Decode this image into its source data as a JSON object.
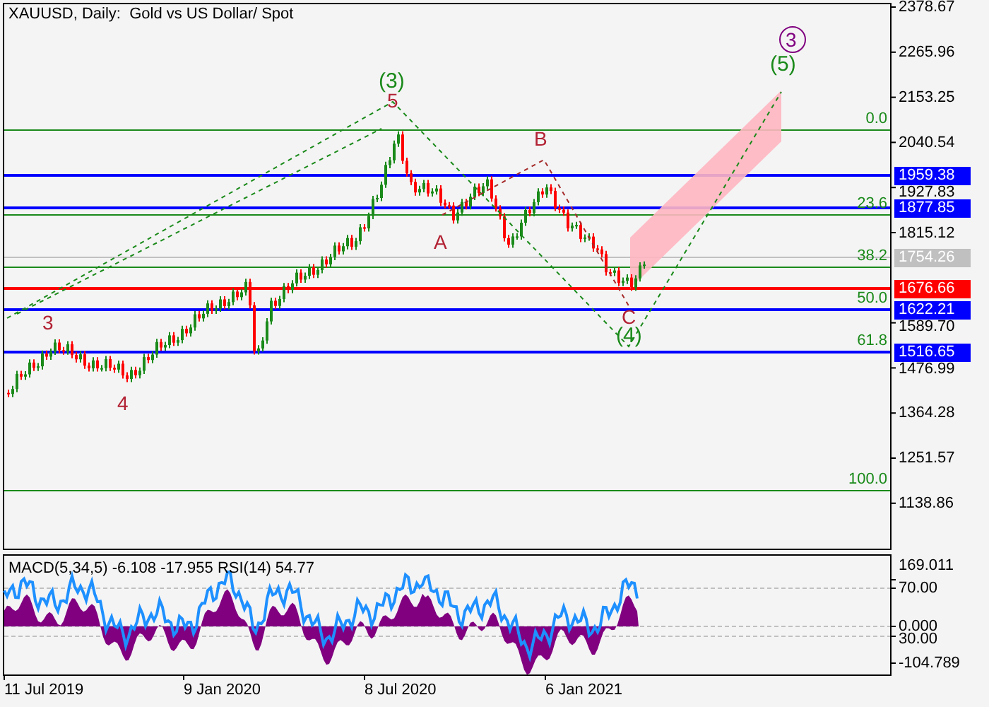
{
  "chart": {
    "title": "XAUUSD, Daily:  Gold vs US Dollar/ Spot",
    "price_axis": [
      "2378.67",
      "2265.96",
      "2153.25",
      "2040.54",
      "1927.83",
      "1815.12",
      "1589.70",
      "1476.99",
      "1364.28",
      "1251.57",
      "1138.86"
    ],
    "price_tags": [
      {
        "text": "1959.38",
        "color": "#0000ff"
      },
      {
        "text": "1877.85",
        "color": "#0000ff"
      },
      {
        "text": "1754.26",
        "color": "#c0c0c0"
      },
      {
        "text": "1676.66",
        "color": "#ff0000"
      },
      {
        "text": "1622.21",
        "color": "#0000ff"
      },
      {
        "text": "1516.65",
        "color": "#0000ff"
      }
    ],
    "fib_levels": [
      "0.0",
      "23.6",
      "38.2",
      "50.0",
      "61.8",
      "100.0"
    ],
    "wave_labels": [
      {
        "text": "(3)",
        "kind": "intermediate"
      },
      {
        "text": "5",
        "kind": "minor"
      },
      {
        "text": "3",
        "kind": "minor"
      },
      {
        "text": "4",
        "kind": "minor"
      },
      {
        "text": "A",
        "kind": "minor"
      },
      {
        "text": "B",
        "kind": "minor"
      },
      {
        "text": "C",
        "kind": "minor"
      },
      {
        "text": "(4)",
        "kind": "intermediate"
      },
      {
        "text": "3",
        "kind": "circled"
      },
      {
        "text": "(5)",
        "kind": "intermediate"
      }
    ]
  },
  "indicator": {
    "title": "MACD(5,34,5) -6.108 -17.955 RSI(14) 54.77",
    "axis": [
      "169.011",
      "70.00",
      "0.000",
      "30.00",
      "-104.789"
    ]
  },
  "time_axis": [
    "11 Jul 2019",
    "9 Jan 2020",
    "8 Jul 2020",
    "6 Jan 2021"
  ]
}
